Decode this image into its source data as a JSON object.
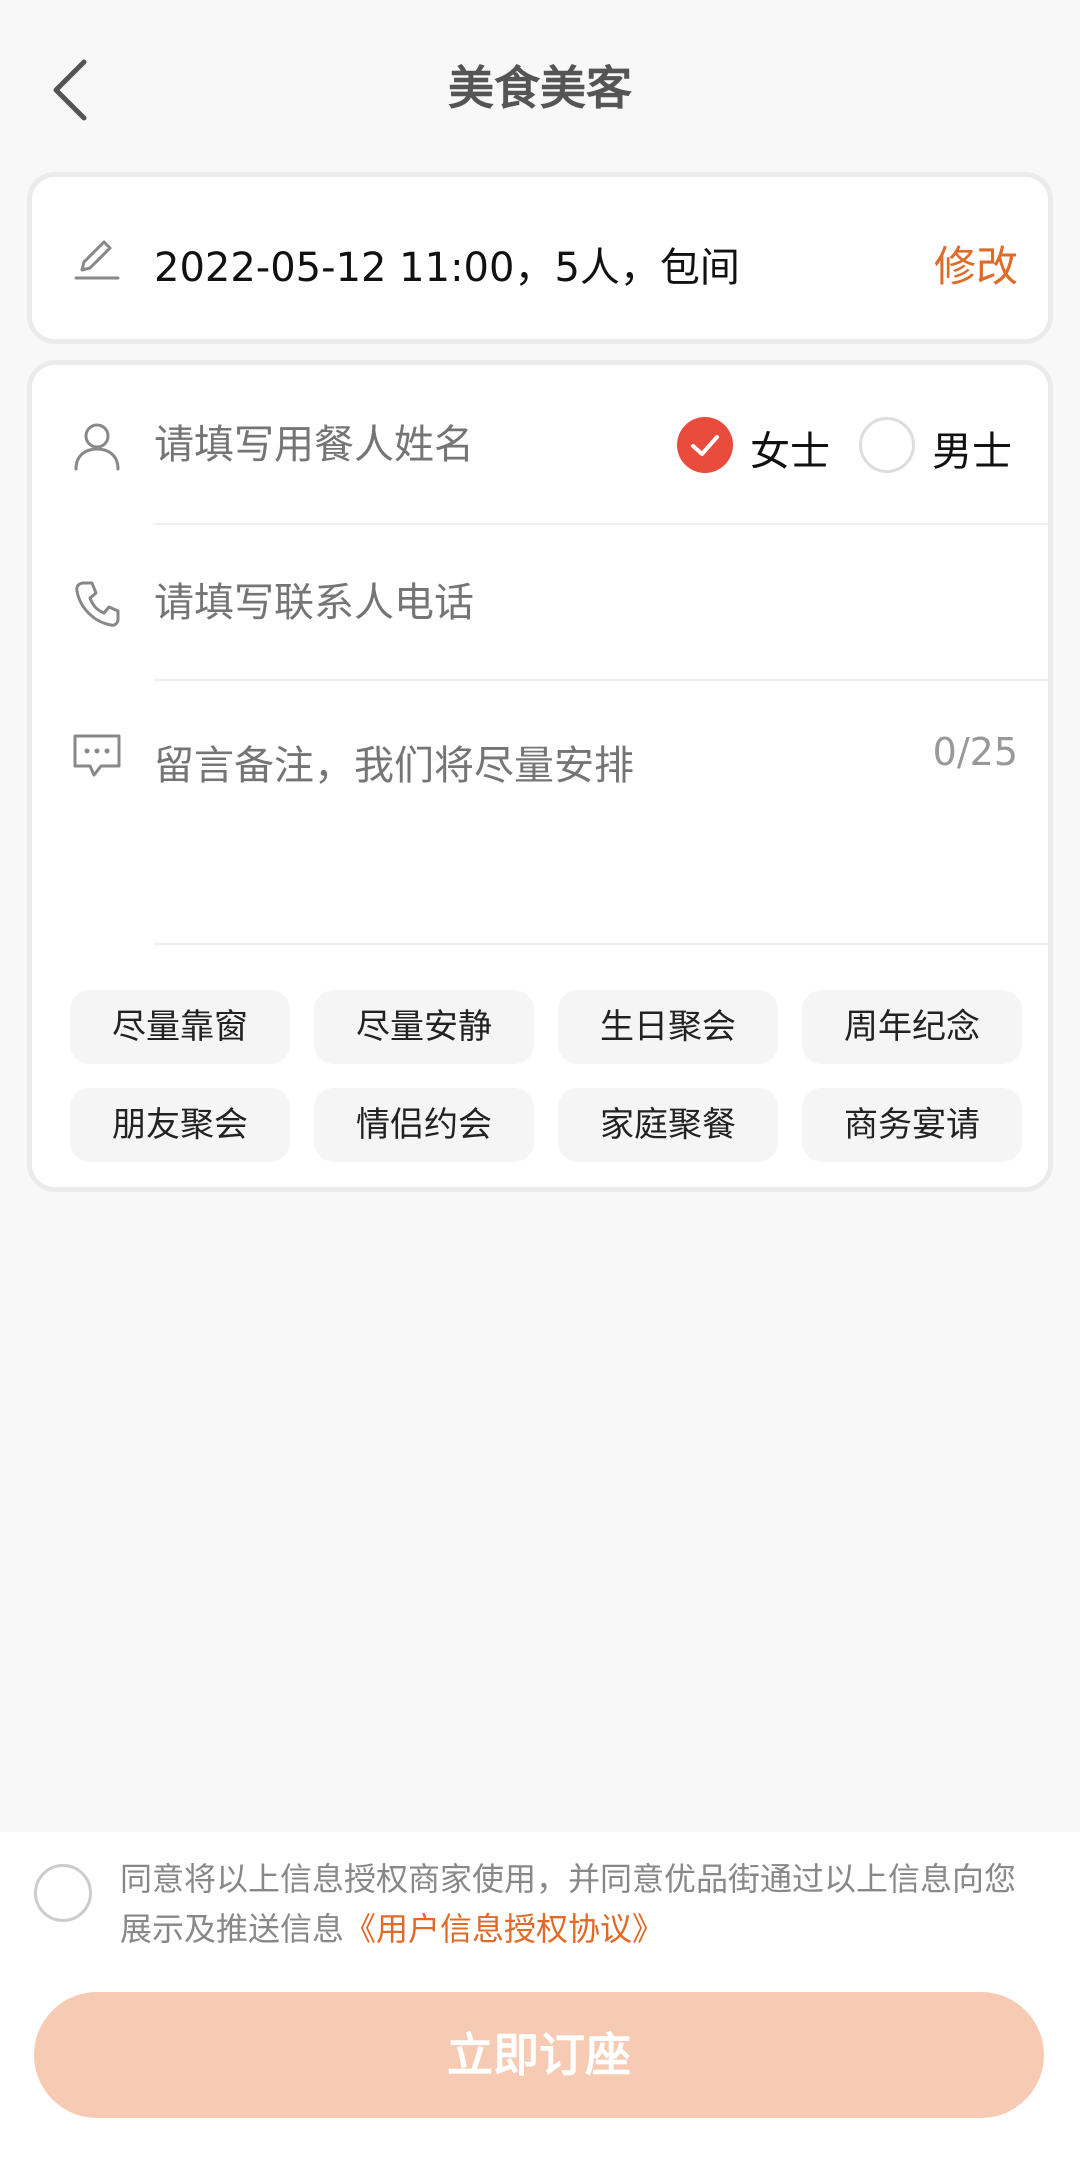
{
  "header": {
    "title": "美食美客"
  },
  "booking": {
    "summary": "2022-05-12 11:00，5人，包间",
    "modify_label": "修改"
  },
  "form": {
    "name_placeholder": "请填写用餐人姓名",
    "gender_options": [
      {
        "label": "女士",
        "selected": true
      },
      {
        "label": "男士",
        "selected": false
      }
    ],
    "phone_placeholder": "请填写联系人电话",
    "remark_placeholder": "留言备注，我们将尽量安排",
    "remark_counter": "0/25"
  },
  "tags": [
    "尽量靠窗",
    "尽量安静",
    "生日聚会",
    "周年纪念",
    "朋友聚会",
    "情侣约会",
    "家庭聚餐",
    "商务宴请"
  ],
  "footer": {
    "agree_text": "同意将以上信息授权商家使用，并同意优品街通过以上信息向您展示及推送信息",
    "agree_link": "《用户信息授权协议》",
    "submit_label": "立即订座"
  },
  "colors": {
    "accent": "#e06a28",
    "checked": "#e94b3c",
    "submit_bg": "#f7cbb3"
  }
}
